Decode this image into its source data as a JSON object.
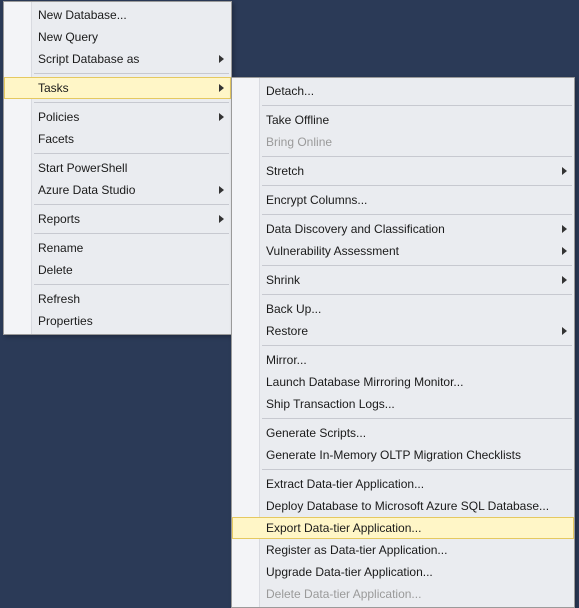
{
  "main_menu": {
    "items": [
      {
        "label": "New Database...",
        "name": "new-database"
      },
      {
        "label": "New Query",
        "name": "new-query"
      },
      {
        "label": "Script Database as",
        "name": "script-database-as",
        "submenu": true
      },
      {
        "sep": true
      },
      {
        "label": "Tasks",
        "name": "tasks",
        "submenu": true,
        "highlight": true
      },
      {
        "sep": true
      },
      {
        "label": "Policies",
        "name": "policies",
        "submenu": true
      },
      {
        "label": "Facets",
        "name": "facets"
      },
      {
        "sep": true
      },
      {
        "label": "Start PowerShell",
        "name": "start-powershell"
      },
      {
        "label": "Azure Data Studio",
        "name": "azure-data-studio",
        "submenu": true
      },
      {
        "sep": true
      },
      {
        "label": "Reports",
        "name": "reports",
        "submenu": true
      },
      {
        "sep": true
      },
      {
        "label": "Rename",
        "name": "rename"
      },
      {
        "label": "Delete",
        "name": "delete"
      },
      {
        "sep": true
      },
      {
        "label": "Refresh",
        "name": "refresh"
      },
      {
        "label": "Properties",
        "name": "properties"
      }
    ]
  },
  "tasks_submenu": {
    "items": [
      {
        "label": "Detach...",
        "name": "detach"
      },
      {
        "sep": true
      },
      {
        "label": "Take Offline",
        "name": "take-offline"
      },
      {
        "label": "Bring Online",
        "name": "bring-online",
        "disabled": true
      },
      {
        "sep": true
      },
      {
        "label": "Stretch",
        "name": "stretch",
        "submenu": true
      },
      {
        "sep": true
      },
      {
        "label": "Encrypt Columns...",
        "name": "encrypt-columns"
      },
      {
        "sep": true
      },
      {
        "label": "Data Discovery and Classification",
        "name": "data-discovery",
        "submenu": true
      },
      {
        "label": "Vulnerability Assessment",
        "name": "vulnerability-assessment",
        "submenu": true
      },
      {
        "sep": true
      },
      {
        "label": "Shrink",
        "name": "shrink",
        "submenu": true
      },
      {
        "sep": true
      },
      {
        "label": "Back Up...",
        "name": "back-up"
      },
      {
        "label": "Restore",
        "name": "restore",
        "submenu": true
      },
      {
        "sep": true
      },
      {
        "label": "Mirror...",
        "name": "mirror"
      },
      {
        "label": "Launch Database Mirroring Monitor...",
        "name": "launch-mirroring-monitor"
      },
      {
        "label": "Ship Transaction Logs...",
        "name": "ship-transaction-logs"
      },
      {
        "sep": true
      },
      {
        "label": "Generate Scripts...",
        "name": "generate-scripts"
      },
      {
        "label": "Generate In-Memory OLTP Migration Checklists",
        "name": "generate-oltp-checklists"
      },
      {
        "sep": true
      },
      {
        "label": "Extract Data-tier Application...",
        "name": "extract-dacpac"
      },
      {
        "label": "Deploy Database to Microsoft Azure SQL Database...",
        "name": "deploy-azure-sql"
      },
      {
        "label": "Export Data-tier Application...",
        "name": "export-dacpac",
        "highlight": true
      },
      {
        "label": "Register as Data-tier Application...",
        "name": "register-dacpac"
      },
      {
        "label": "Upgrade Data-tier Application...",
        "name": "upgrade-dacpac"
      },
      {
        "label": "Delete Data-tier Application...",
        "name": "delete-dacpac",
        "disabled": true
      }
    ]
  }
}
